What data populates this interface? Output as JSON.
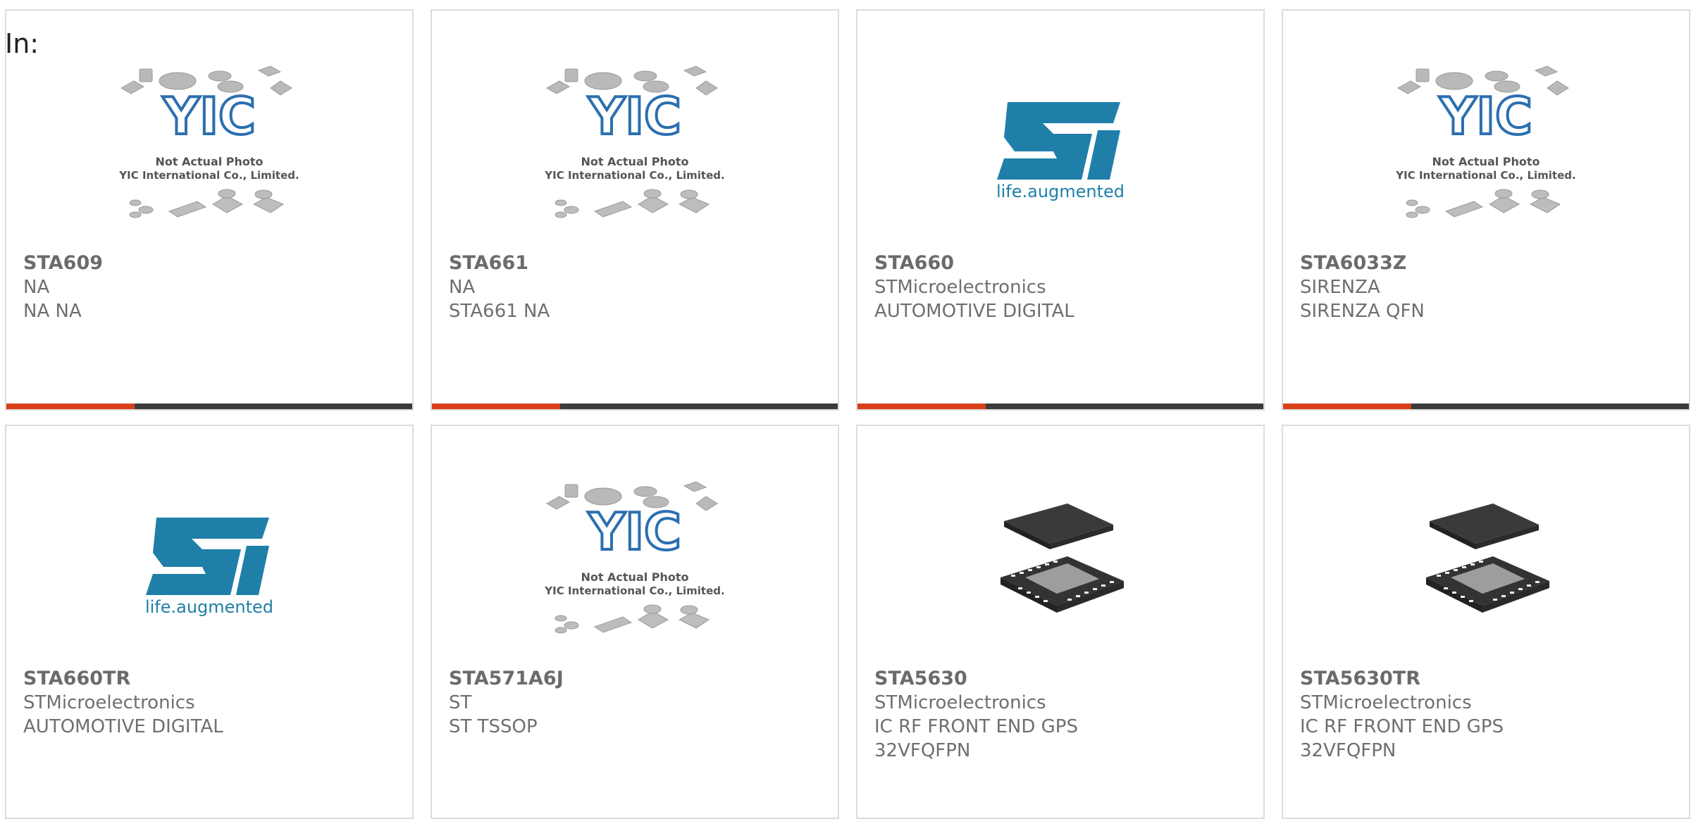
{
  "header": {
    "in_label": "In:"
  },
  "placeholder": {
    "line1": "Not Actual Photo",
    "line2": "YIC International Co., Limited."
  },
  "st_logo": {
    "tagline": "life.augmented"
  },
  "colors": {
    "accent": "#d8401a",
    "bar": "#3b3b3b",
    "st_blue": "#1f7fa8"
  },
  "products": [
    {
      "part": "STA609",
      "maker": "NA",
      "desc": "NA NA",
      "image": "yic-placeholder"
    },
    {
      "part": "STA661",
      "maker": "NA",
      "desc": "STA661 NA",
      "image": "yic-placeholder"
    },
    {
      "part": "STA660",
      "maker": "STMicroelectronics",
      "desc": "AUTOMOTIVE DIGITAL",
      "image": "st-logo"
    },
    {
      "part": "STA6033Z",
      "maker": "SIRENZA",
      "desc": "SIRENZA QFN",
      "image": "yic-placeholder"
    },
    {
      "part": "STA660TR",
      "maker": "STMicroelectronics",
      "desc": "AUTOMOTIVE DIGITAL",
      "image": "st-logo"
    },
    {
      "part": "STA571A6J",
      "maker": "ST",
      "desc": "ST TSSOP",
      "image": "yic-placeholder"
    },
    {
      "part": "STA5630",
      "maker": "STMicroelectronics",
      "desc": "IC RF FRONT END GPS 32VFQFPN",
      "image": "qfn-chip"
    },
    {
      "part": "STA5630TR",
      "maker": "STMicroelectronics",
      "desc": "IC RF FRONT END GPS 32VFQFPN",
      "image": "qfn-chip"
    }
  ]
}
